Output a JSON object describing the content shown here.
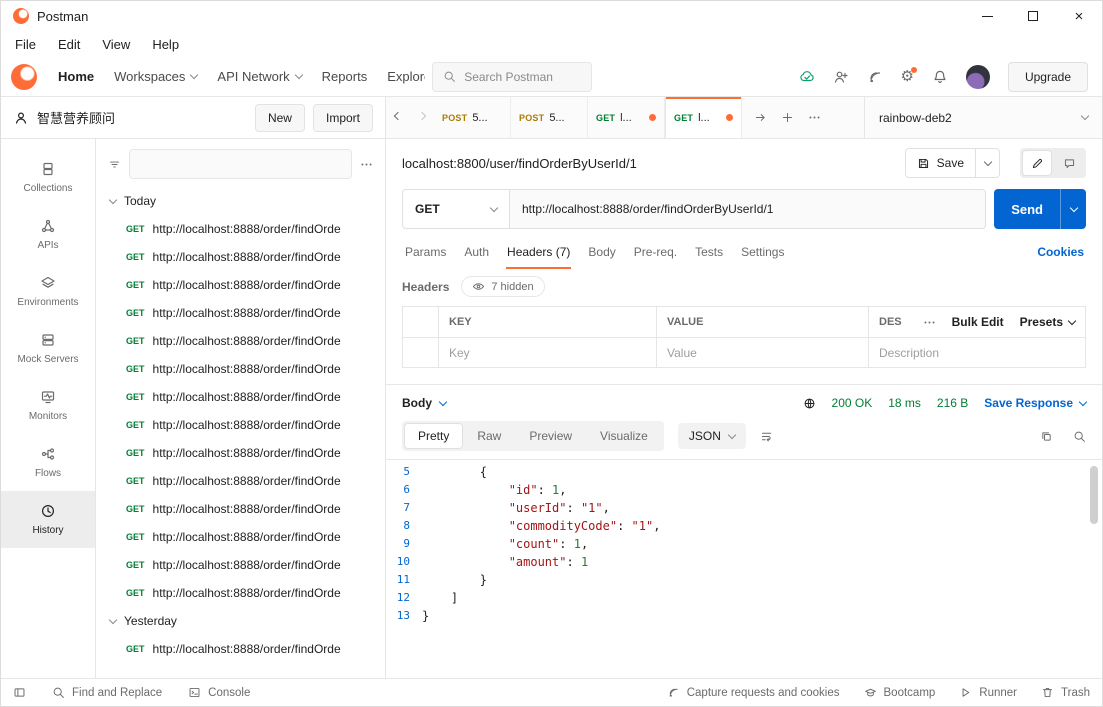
{
  "colors": {
    "accent": "#ff6c37",
    "send_blue": "#0265d2",
    "get_green": "#007f31",
    "post_orange": "#ad7a03"
  },
  "titlebar": {
    "app_name": "Postman"
  },
  "menubar": {
    "items": [
      "File",
      "Edit",
      "View",
      "Help"
    ]
  },
  "toolbar": {
    "nav": [
      "Home",
      "Workspaces",
      "API Network",
      "Reports",
      "Explore"
    ],
    "search_placeholder": "Search Postman",
    "upgrade_label": "Upgrade"
  },
  "workspace": {
    "title": "智慧营养顾问",
    "new_label": "New",
    "import_label": "Import"
  },
  "rail": {
    "items": [
      "Collections",
      "APIs",
      "Environments",
      "Mock Servers",
      "Monitors",
      "Flows",
      "History"
    ],
    "active": "History"
  },
  "tabstrip": {
    "tabs": [
      {
        "method": "POST",
        "label": "5...",
        "dot": false,
        "active": false
      },
      {
        "method": "POST",
        "label": "5...",
        "dot": false,
        "active": false
      },
      {
        "method": "GET",
        "label": "l...",
        "dot": true,
        "active": false
      },
      {
        "method": "GET",
        "label": "l...",
        "dot": true,
        "active": true
      }
    ],
    "environment": "rainbow-deb2"
  },
  "history": {
    "sections": [
      {
        "label": "Today",
        "items": [
          {
            "method": "GET",
            "url": "http://localhost:8888/order/findOrde"
          },
          {
            "method": "GET",
            "url": "http://localhost:8888/order/findOrde"
          },
          {
            "method": "GET",
            "url": "http://localhost:8888/order/findOrde"
          },
          {
            "method": "GET",
            "url": "http://localhost:8888/order/findOrde"
          },
          {
            "method": "GET",
            "url": "http://localhost:8888/order/findOrde"
          },
          {
            "method": "GET",
            "url": "http://localhost:8888/order/findOrde"
          },
          {
            "method": "GET",
            "url": "http://localhost:8888/order/findOrde"
          },
          {
            "method": "GET",
            "url": "http://localhost:8888/order/findOrde"
          },
          {
            "method": "GET",
            "url": "http://localhost:8888/order/findOrde"
          },
          {
            "method": "GET",
            "url": "http://localhost:8888/order/findOrde"
          },
          {
            "method": "GET",
            "url": "http://localhost:8888/order/findOrde"
          },
          {
            "method": "GET",
            "url": "http://localhost:8888/order/findOrde"
          },
          {
            "method": "GET",
            "url": "http://localhost:8888/order/findOrde"
          },
          {
            "method": "GET",
            "url": "http://localhost:8888/order/findOrde"
          }
        ]
      },
      {
        "label": "Yesterday",
        "items": [
          {
            "method": "GET",
            "url": "http://localhost:8888/order/findOrde"
          }
        ]
      }
    ]
  },
  "request": {
    "title": "localhost:8800/user/findOrderByUserId/1",
    "save_label": "Save",
    "method": "GET",
    "url": "http://localhost:8888/order/findOrderByUserId/1",
    "send_label": "Send",
    "tabs": [
      "Params",
      "Auth",
      "Headers (7)",
      "Body",
      "Pre-req.",
      "Tests",
      "Settings"
    ],
    "cookies_label": "Cookies",
    "headers_section_label": "Headers",
    "hidden_badge": "7 hidden",
    "table": {
      "columns": [
        "KEY",
        "VALUE",
        "DES"
      ],
      "bulk_edit_label": "Bulk Edit",
      "presets_label": "Presets",
      "row_placeholders": {
        "key": "Key",
        "value": "Value",
        "description": "Description"
      }
    }
  },
  "response": {
    "body_label": "Body",
    "status": "200 OK",
    "time": "18 ms",
    "size": "216 B",
    "save_response_label": "Save Response",
    "views": [
      "Pretty",
      "Raw",
      "Preview",
      "Visualize"
    ],
    "active_view": "Pretty",
    "format": "JSON",
    "code_lines": [
      {
        "no": 5,
        "indent": 8,
        "tokens": [
          [
            "p",
            "{"
          ]
        ]
      },
      {
        "no": 6,
        "indent": 12,
        "tokens": [
          [
            "s",
            "\"id\""
          ],
          [
            "p",
            ": "
          ],
          [
            "n",
            "1"
          ],
          [
            "p",
            ","
          ]
        ]
      },
      {
        "no": 7,
        "indent": 12,
        "tokens": [
          [
            "s",
            "\"userId\""
          ],
          [
            "p",
            ": "
          ],
          [
            "s",
            "\"1\""
          ],
          [
            "p",
            ","
          ]
        ]
      },
      {
        "no": 8,
        "indent": 12,
        "tokens": [
          [
            "s",
            "\"commodityCode\""
          ],
          [
            "p",
            ": "
          ],
          [
            "s",
            "\"1\""
          ],
          [
            "p",
            ","
          ]
        ]
      },
      {
        "no": 9,
        "indent": 12,
        "tokens": [
          [
            "s",
            "\"count\""
          ],
          [
            "p",
            ": "
          ],
          [
            "n",
            "1"
          ],
          [
            "p",
            ","
          ]
        ]
      },
      {
        "no": 10,
        "indent": 12,
        "tokens": [
          [
            "s",
            "\"amount\""
          ],
          [
            "p",
            ": "
          ],
          [
            "n",
            "1"
          ]
        ]
      },
      {
        "no": 11,
        "indent": 8,
        "tokens": [
          [
            "p",
            "}"
          ]
        ]
      },
      {
        "no": 12,
        "indent": 4,
        "tokens": [
          [
            "p",
            "]"
          ]
        ]
      },
      {
        "no": 13,
        "indent": 0,
        "tokens": [
          [
            "p",
            "}"
          ]
        ]
      }
    ]
  },
  "statusbar": {
    "left": [
      "Find and Replace",
      "Console"
    ],
    "right": [
      "Capture requests and cookies",
      "Bootcamp",
      "Runner",
      "Trash"
    ]
  }
}
